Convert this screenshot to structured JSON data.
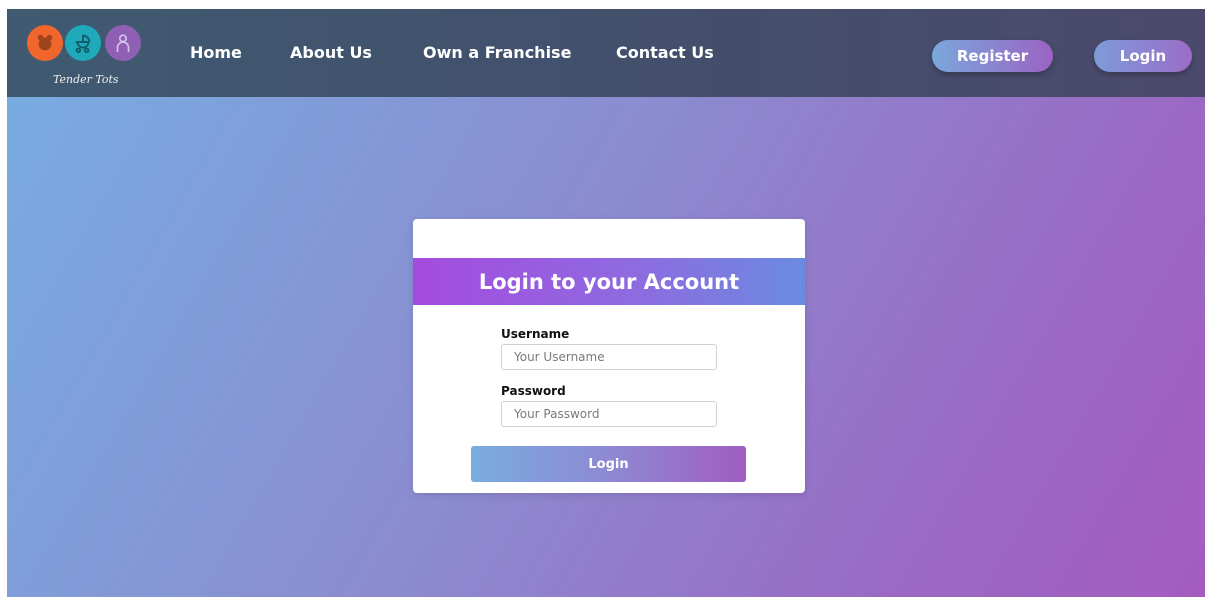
{
  "brand": {
    "name": "Tender Tots",
    "logo_icons": [
      "teddy-bear-icon",
      "stroller-icon",
      "baby-icon"
    ],
    "logo_colors": [
      "#f0662c",
      "#20a9bb",
      "#8f5fb3"
    ]
  },
  "nav": {
    "links": [
      "Home",
      "About Us",
      "Own a Franchise",
      "Contact Us"
    ],
    "register_label": "Register",
    "login_label": "Login"
  },
  "login_form": {
    "title": "Login to your Account",
    "username_label": "Username",
    "username_placeholder": "Your Username",
    "username_value": "",
    "password_label": "Password",
    "password_placeholder": "Your Password",
    "password_value": "",
    "submit_label": "Login"
  },
  "colors": {
    "header_bg": "#434f6c",
    "title_band_start": "#a44bdf",
    "title_band_end": "#6a8be0",
    "page_gradient_start": "#76aee2",
    "page_gradient_end": "#a45cbf"
  }
}
